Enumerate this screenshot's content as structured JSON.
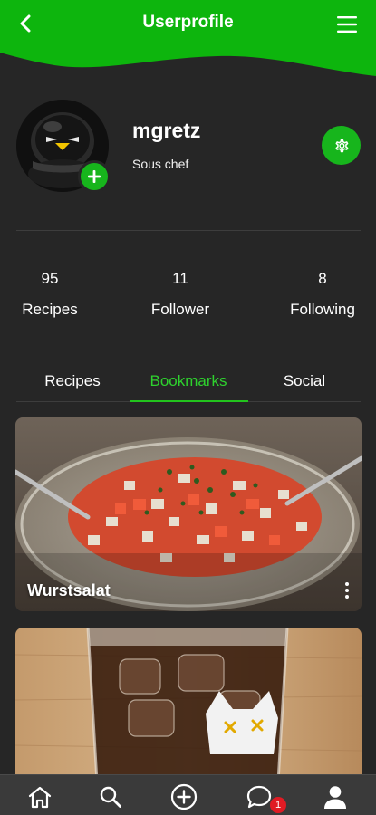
{
  "header": {
    "title": "Userprofile",
    "back_icon": "chevron-left-icon",
    "menu_icon": "hamburger-menu-icon",
    "color": "#0db50d"
  },
  "profile": {
    "username": "mgretz",
    "role": "Sous chef",
    "avatar_icon": "penguin-avatar",
    "add_icon": "plus-icon",
    "settings_icon": "gear-icon",
    "accent": "#17b51c"
  },
  "stats": [
    {
      "value": "95",
      "label": "Recipes"
    },
    {
      "value": "11",
      "label": "Follower"
    },
    {
      "value": "8",
      "label": "Following"
    }
  ],
  "tabs": [
    {
      "label": "Recipes",
      "active": false
    },
    {
      "label": "Bookmarks",
      "active": true
    },
    {
      "label": "Social",
      "active": false
    }
  ],
  "cards": [
    {
      "title": "Wurstsalat",
      "more_icon": "more-vertical-icon"
    },
    {
      "title": "",
      "more_icon": "more-vertical-icon"
    }
  ],
  "bottom_nav": {
    "items": [
      "home-icon",
      "search-icon",
      "add-circle-icon",
      "chat-icon",
      "user-icon"
    ],
    "chat_badge": "1"
  }
}
